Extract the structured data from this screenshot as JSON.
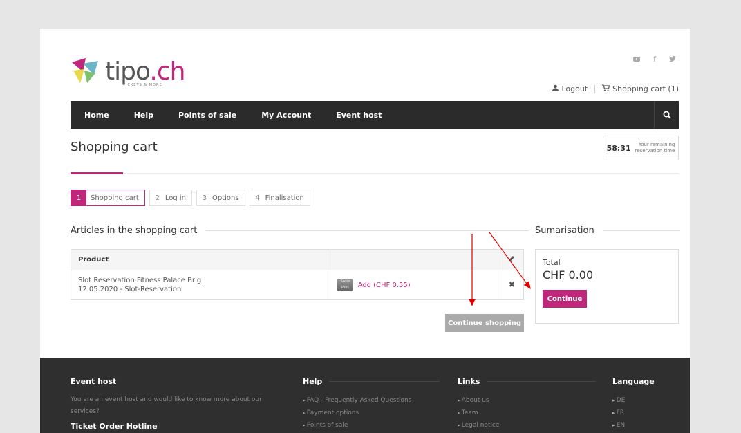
{
  "header": {
    "logo_text_main": "tipo",
    "logo_text_dot": ".ch",
    "logo_sub": "TICKETS & MORE",
    "social": [
      {
        "icon": "youtube-icon",
        "glyph": "▶"
      },
      {
        "icon": "facebook-icon",
        "glyph": "f"
      },
      {
        "icon": "twitter-icon",
        "glyph": "🐦"
      }
    ],
    "logout_label": "Logout",
    "cart_label": "Shopping cart (1)"
  },
  "nav": {
    "items": [
      "Home",
      "Help",
      "Points of sale",
      "My Account",
      "Event host"
    ]
  },
  "page": {
    "title": "Shopping cart",
    "timer": "58:31",
    "timer_label_line1": "Your remaining",
    "timer_label_line2": "reservation time"
  },
  "steps": [
    {
      "num": "1",
      "label": "Shopping cart"
    },
    {
      "num": "2",
      "label": "Log in"
    },
    {
      "num": "3",
      "label": "Options"
    },
    {
      "num": "4",
      "label": "Finalisation"
    }
  ],
  "cart": {
    "heading": "Articles in the shopping cart",
    "col_product": "Product",
    "item_name": "Slot Reservation Fitness Palace Brig",
    "item_sub": "12.05.2020 - Slot-Reservation",
    "pass_icon_text": "Swiss Pass",
    "add_label": "Add (CHF 0.55)",
    "continue_shopping": "Continue shopping"
  },
  "summary": {
    "heading": "Sumarisation",
    "total_label": "Total",
    "total_value": "CHF 0.00",
    "continue": "Continue"
  },
  "footer": {
    "event_host_heading": "Event host",
    "event_host_text": "You are an event host and would like to know more about our services?",
    "hotline_heading": "Ticket Order Hotline",
    "help_heading": "Help",
    "help_items": [
      "FAQ - Frequently Asked Questions",
      "Payment options",
      "Points of sale"
    ],
    "links_heading": "Links",
    "links_items": [
      "About us",
      "Team",
      "Legal notice"
    ],
    "language_heading": "Language",
    "language_items": [
      "DE",
      "FR",
      "EN"
    ]
  },
  "colors": {
    "accent": "#c0267a",
    "nav_bg": "#2b2b2b",
    "footer_bg": "#2f2f2f",
    "annotation_arrow": "#e00000"
  }
}
